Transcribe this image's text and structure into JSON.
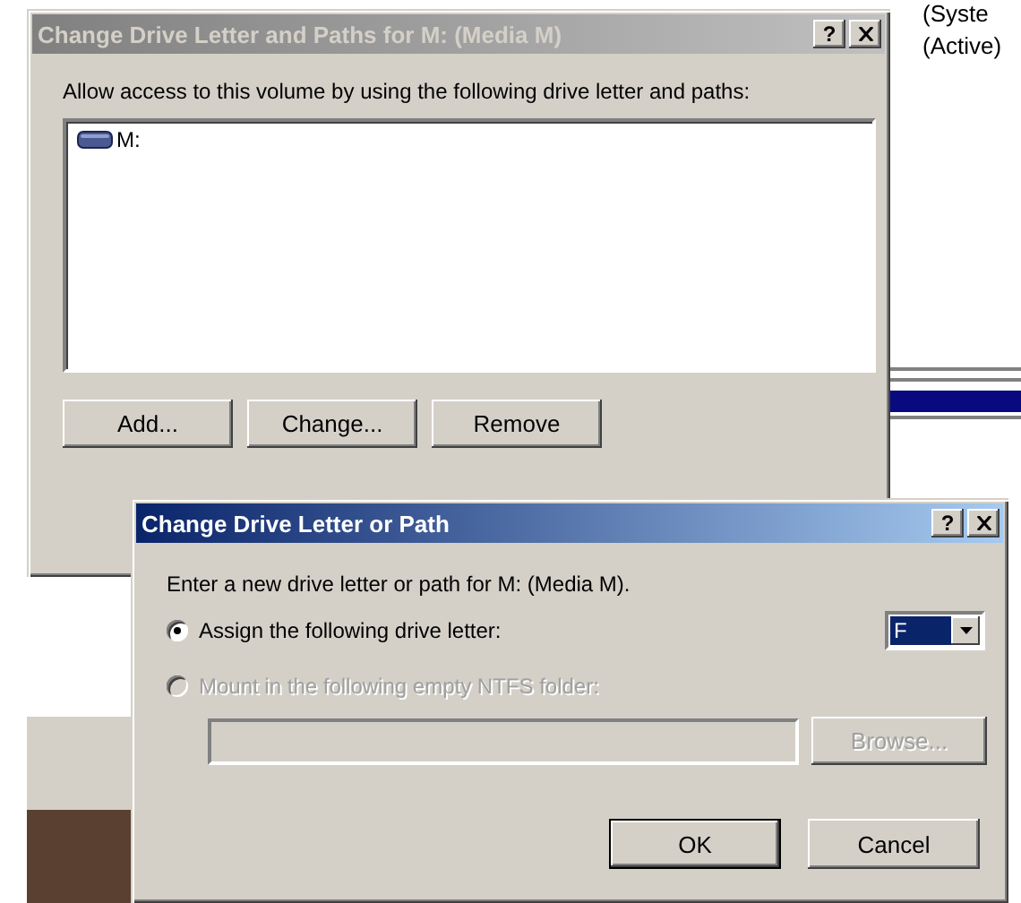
{
  "background": {
    "labels": [
      "(Syste",
      "(Active)"
    ]
  },
  "paths_dialog": {
    "title": "Change Drive Letter and Paths for M: (Media M)",
    "active": false,
    "help": "?",
    "instruction": "Allow access to this volume by using the following drive letter and paths:",
    "paths": [
      {
        "label": "M:",
        "selected": false
      }
    ],
    "buttons": [
      {
        "label": "Add...",
        "disabled": false
      },
      {
        "label": "Change...",
        "disabled": false
      },
      {
        "label": "Remove",
        "disabled": false
      }
    ]
  },
  "letter_dialog": {
    "title": "Change Drive Letter or Path",
    "active": true,
    "help": "?",
    "prompt": "Enter a new drive letter or path for M: (Media M).",
    "options": [
      {
        "label": "Assign the following drive letter:",
        "selected": true,
        "disabled": false
      },
      {
        "label": "Mount in the following empty NTFS folder:",
        "selected": false,
        "disabled": true
      }
    ],
    "drive_letter": {
      "value": "F"
    },
    "folder_field": {
      "disabled": true
    },
    "browse_button": {
      "label": "Browse...",
      "disabled": true
    },
    "buttons": [
      {
        "label": "OK",
        "default": true
      },
      {
        "label": "Cancel",
        "default": false
      }
    ]
  }
}
